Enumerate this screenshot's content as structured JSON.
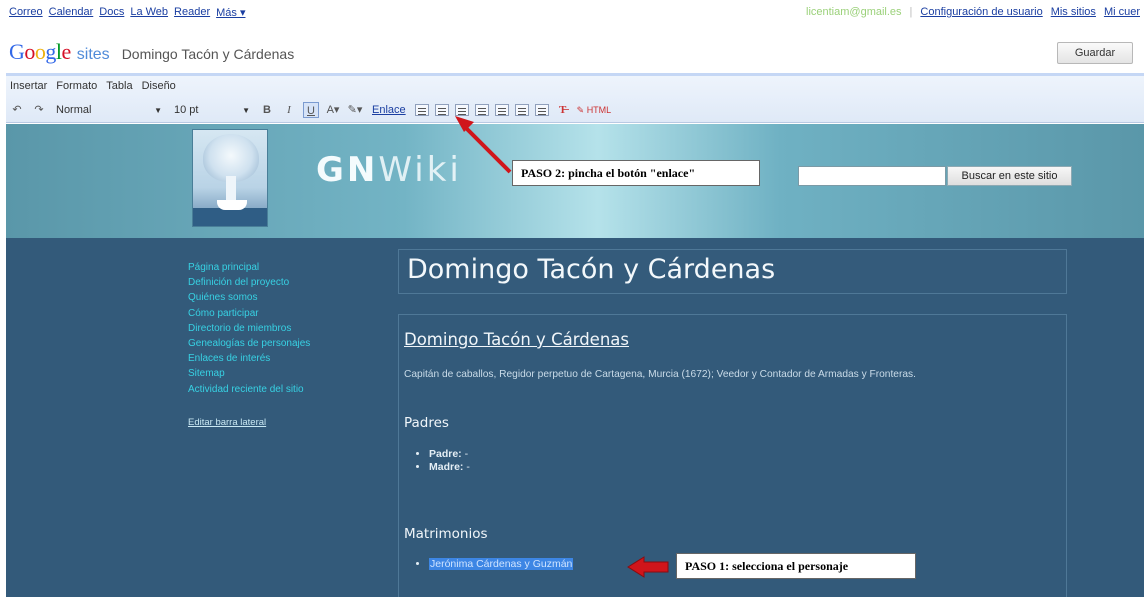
{
  "gbar": {
    "links": [
      "Correo",
      "Calendar",
      "Docs",
      "La Web",
      "Reader",
      "Más ▾"
    ],
    "email": "licentiam@gmail.es",
    "right_links": [
      "Configuración de usuario",
      "Mis sitios",
      "Mi cuer"
    ]
  },
  "header": {
    "logo": "Google",
    "product": "sites",
    "site_name": "Domingo Tacón y Cárdenas",
    "save_label": "Guardar"
  },
  "menu": [
    "Insertar",
    "Formato",
    "Tabla",
    "Diseño"
  ],
  "toolbar": {
    "style_value": "Normal",
    "size_value": "10 pt",
    "link_label": "Enlace",
    "html_label": "HTML"
  },
  "banner": {
    "title_bold": "GN",
    "title_rest": "Wiki",
    "search_button": "Buscar en este sitio"
  },
  "sidebar": {
    "items": [
      "Página principal",
      "Definición del proyecto",
      "Quiénes somos",
      "Cómo participar",
      "Directorio de miembros",
      "Genealogías de personajes",
      "Enlaces de interés",
      "Sitemap",
      "Actividad reciente del sitio"
    ],
    "edit_link": "Editar barra lateral"
  },
  "page": {
    "title": "Domingo Tacón y Cárdenas",
    "heading": "Domingo Tacón y Cárdenas",
    "description": "Capitán de caballos, Regidor perpetuo de Cartagena, Murcia (1672); Veedor y Contador de Armadas y Fronteras.",
    "section_parents": "Padres",
    "father_label": "Padre:",
    "father_value": " -",
    "mother_label": "Madre:",
    "mother_value": " -",
    "section_marriages": "Matrimonios",
    "spouse": "Jerónima Cárdenas y Guzmán"
  },
  "annotations": {
    "step2": "PASO 2: pincha el botón \"enlace\"",
    "step1": "PASO 1: selecciona el personaje"
  },
  "colors": {
    "arrow": "#d0151b",
    "site_body": "#335a7a",
    "nav_link": "#37d1e3",
    "selection": "#3d86e4"
  }
}
